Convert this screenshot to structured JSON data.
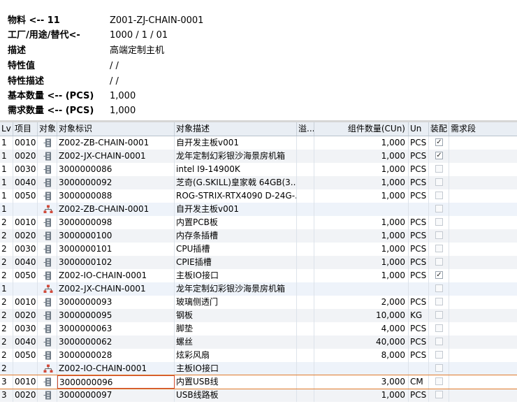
{
  "header": {
    "material_label": "物料 <-- 11",
    "material_value": "Z001-ZJ-CHAIN-0001",
    "plant_label": "工厂/用途/替代<-",
    "plant_value": "1000 / 1 / 01",
    "desc_label": "描述",
    "desc_value": "高端定制主机",
    "char_label": "特性值",
    "char_value": "/ /",
    "chardesc_label": "特性描述",
    "chardesc_value": "/ /",
    "basic_label": "基本数量 <-- (PCS)",
    "basic_value": "1,000",
    "req_label": "需求数量 <-- (PCS)",
    "req_value": "1,000"
  },
  "columns": {
    "lv": "Lv",
    "item": "项目",
    "obj": "对象",
    "obj_id": "对象标识",
    "obj_desc": "对象描述",
    "overflow": "溢...",
    "qty": "组件数量(CUn)",
    "unit": "Un",
    "assembly": "装配",
    "req_seg": "需求段"
  },
  "rows": [
    {
      "lv": "1",
      "item": "0010",
      "icon": "material-icon",
      "id": "Z002-ZB-CHAIN-0001",
      "desc": "自开发主板v001",
      "qty": "1,000",
      "unit": "PCS",
      "chk": true,
      "style": "white"
    },
    {
      "lv": "1",
      "item": "0020",
      "icon": "material-icon",
      "id": "Z002-JX-CHAIN-0001",
      "desc": "龙年定制幻彩银沙海景房机箱",
      "qty": "1,000",
      "unit": "PCS",
      "chk": true,
      "style": "alt"
    },
    {
      "lv": "1",
      "item": "0030",
      "icon": "material-icon",
      "id": "3000000086",
      "desc": "intel I9-14900K",
      "qty": "1,000",
      "unit": "PCS",
      "chk": false,
      "style": "white"
    },
    {
      "lv": "1",
      "item": "0040",
      "icon": "material-icon",
      "id": "3000000092",
      "desc": "芝奇(G.SKILL)皇家戟 64GB(3...",
      "qty": "1,000",
      "unit": "PCS",
      "chk": false,
      "style": "alt"
    },
    {
      "lv": "1",
      "item": "0050",
      "icon": "material-icon",
      "id": "3000000088",
      "desc": "ROG-STRIX-RTX4090 D-24G-...",
      "qty": "1,000",
      "unit": "PCS",
      "chk": false,
      "style": "white"
    },
    {
      "lv": "1",
      "item": "",
      "icon": "bom-icon",
      "id": "Z002-ZB-CHAIN-0001",
      "desc": "自开发主板v001",
      "qty": "",
      "unit": "",
      "chk": false,
      "style": "item"
    },
    {
      "lv": "2",
      "item": "0010",
      "icon": "material-icon",
      "id": "3000000098",
      "desc": "内置PCB板",
      "qty": "1,000",
      "unit": "PCS",
      "chk": false,
      "style": "white"
    },
    {
      "lv": "2",
      "item": "0020",
      "icon": "material-icon",
      "id": "3000000100",
      "desc": "内存条插槽",
      "qty": "1,000",
      "unit": "PCS",
      "chk": false,
      "style": "alt"
    },
    {
      "lv": "2",
      "item": "0030",
      "icon": "material-icon",
      "id": "3000000101",
      "desc": "CPU插槽",
      "qty": "1,000",
      "unit": "PCS",
      "chk": false,
      "style": "white"
    },
    {
      "lv": "2",
      "item": "0040",
      "icon": "material-icon",
      "id": "3000000102",
      "desc": "CPIE插槽",
      "qty": "1,000",
      "unit": "PCS",
      "chk": false,
      "style": "alt"
    },
    {
      "lv": "2",
      "item": "0050",
      "icon": "material-icon",
      "id": "Z002-IO-CHAIN-0001",
      "desc": "主板IO接口",
      "qty": "1,000",
      "unit": "PCS",
      "chk": true,
      "style": "white"
    },
    {
      "lv": "1",
      "item": "",
      "icon": "bom-icon",
      "id": "Z002-JX-CHAIN-0001",
      "desc": "龙年定制幻彩银沙海景房机箱",
      "qty": "",
      "unit": "",
      "chk": false,
      "style": "item"
    },
    {
      "lv": "2",
      "item": "0010",
      "icon": "material-icon",
      "id": "3000000093",
      "desc": "玻璃侧透门",
      "qty": "2,000",
      "unit": "PCS",
      "chk": false,
      "style": "white"
    },
    {
      "lv": "2",
      "item": "0020",
      "icon": "material-icon",
      "id": "3000000095",
      "desc": "钢板",
      "qty": "10,000",
      "unit": "KG",
      "chk": false,
      "style": "alt"
    },
    {
      "lv": "2",
      "item": "0030",
      "icon": "material-icon",
      "id": "3000000063",
      "desc": "脚垫",
      "qty": "4,000",
      "unit": "PCS",
      "chk": false,
      "style": "white"
    },
    {
      "lv": "2",
      "item": "0040",
      "icon": "material-icon",
      "id": "3000000062",
      "desc": "螺丝",
      "qty": "40,000",
      "unit": "PCS",
      "chk": false,
      "style": "alt"
    },
    {
      "lv": "2",
      "item": "0050",
      "icon": "material-icon",
      "id": "3000000028",
      "desc": "炫彩风扇",
      "qty": "8,000",
      "unit": "PCS",
      "chk": false,
      "style": "white"
    },
    {
      "lv": "2",
      "item": "",
      "icon": "bom-icon",
      "id": "Z002-IO-CHAIN-0001",
      "desc": "主板IO接口",
      "qty": "",
      "unit": "",
      "chk": false,
      "style": "item"
    },
    {
      "lv": "3",
      "item": "0010",
      "icon": "material-icon",
      "id": "3000000096",
      "desc": "内置USB线",
      "qty": "3,000",
      "unit": "CM",
      "chk": false,
      "style": "white",
      "selected": true
    },
    {
      "lv": "3",
      "item": "0020",
      "icon": "material-icon",
      "id": "3000000097",
      "desc": "USB线路板",
      "qty": "1,000",
      "unit": "PCS",
      "chk": false,
      "style": "alt"
    }
  ]
}
